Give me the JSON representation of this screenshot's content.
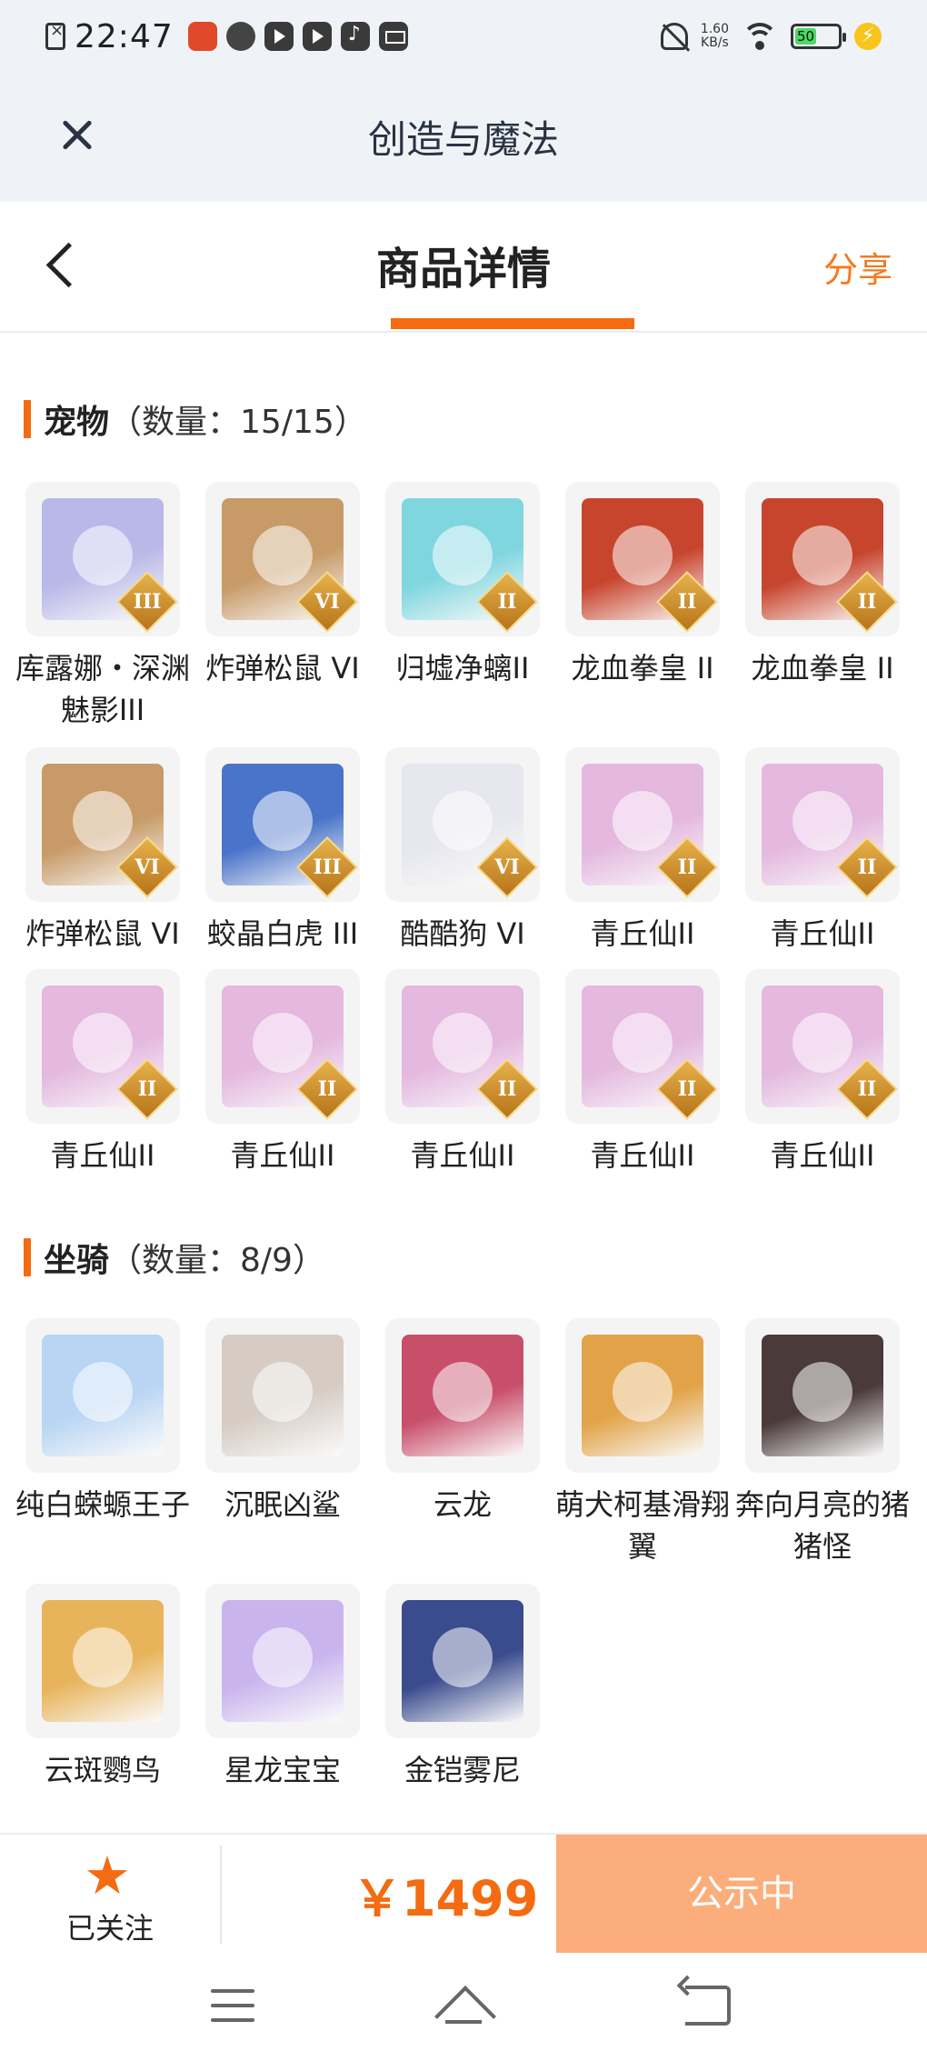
{
  "status_bar": {
    "time": "22:47",
    "net_speed": "1.60",
    "net_unit": "KB/s",
    "battery": "50",
    "app_icons": [
      "red-app-icon",
      "leaf-app-icon",
      "play-app-icon",
      "play-app-icon",
      "music-app-icon",
      "mail-app-icon"
    ]
  },
  "app_bar": {
    "title": "创造与魔法"
  },
  "header": {
    "title": "商品详情",
    "share": "分享"
  },
  "sections": [
    {
      "name": "宠物",
      "count": "（数量：15/15）",
      "items": [
        {
          "name": "库露娜・深渊魅影III",
          "tier": "III",
          "color": "#b9b8e8"
        },
        {
          "name": "炸弹松鼠 VI",
          "tier": "VI",
          "color": "#c79a67"
        },
        {
          "name": "归墟净螭II",
          "tier": "II",
          "color": "#7fd6df"
        },
        {
          "name": "龙血拳皇 II",
          "tier": "II",
          "color": "#c8452d"
        },
        {
          "name": "龙血拳皇 II",
          "tier": "II",
          "color": "#c8452d"
        },
        {
          "name": "炸弹松鼠 VI",
          "tier": "VI",
          "color": "#c79a67"
        },
        {
          "name": "蛟晶白虎 III",
          "tier": "III",
          "color": "#4a74c9"
        },
        {
          "name": "酷酷狗 VI",
          "tier": "VI",
          "color": "#e7e7ef"
        },
        {
          "name": "青丘仙II",
          "tier": "II",
          "color": "#e4b8df"
        },
        {
          "name": "青丘仙II",
          "tier": "II",
          "color": "#e4b8df"
        },
        {
          "name": "青丘仙II",
          "tier": "II",
          "color": "#e4b8df"
        },
        {
          "name": "青丘仙II",
          "tier": "II",
          "color": "#e4b8df"
        },
        {
          "name": "青丘仙II",
          "tier": "II",
          "color": "#e4b8df"
        },
        {
          "name": "青丘仙II",
          "tier": "II",
          "color": "#e4b8df"
        },
        {
          "name": "青丘仙II",
          "tier": "II",
          "color": "#e4b8df"
        }
      ]
    },
    {
      "name": "坐骑",
      "count": "（数量：8/9）",
      "items": [
        {
          "name": "纯白蝾螈王子",
          "color": "#b8d5f3"
        },
        {
          "name": "沉眠凶鲨",
          "color": "#d6ccc4"
        },
        {
          "name": "云龙",
          "color": "#c84f6a"
        },
        {
          "name": "萌犬柯基滑翔翼",
          "color": "#e2a348"
        },
        {
          "name": "奔向月亮的猪猪怪",
          "color": "#4a3a3a"
        },
        {
          "name": "云斑鹦鸟",
          "color": "#e8b45b"
        },
        {
          "name": "星龙宝宝",
          "color": "#c9b4ee"
        },
        {
          "name": "金铠雾尼",
          "color": "#3a4c8e"
        }
      ]
    }
  ],
  "bottom_bar": {
    "follow_label": "已关注",
    "price": "￥1499",
    "status_button": "公示中",
    "accent": "#f46b12"
  }
}
